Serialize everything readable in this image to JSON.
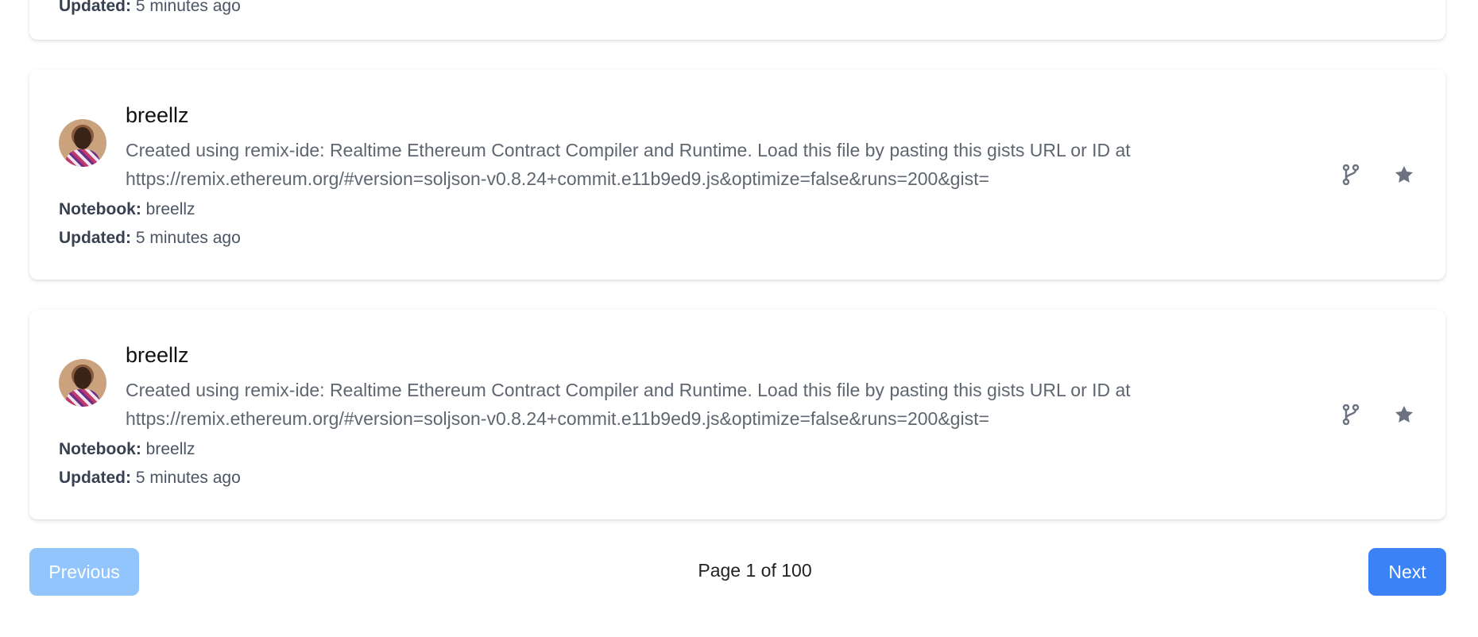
{
  "partial_card": {
    "updated_label": "Updated:",
    "updated_value": "5 minutes ago"
  },
  "cards": [
    {
      "name": "breellz",
      "description_line1": "Created using remix-ide: Realtime Ethereum Contract Compiler and Runtime. Load this file by pasting this gists URL or ID at",
      "description_line2": "https://remix.ethereum.org/#version=soljson-v0.8.24+commit.e11b9ed9.js&optimize=false&runs=200&gist=",
      "notebook_label": "Notebook:",
      "notebook_value": "breellz",
      "updated_label": "Updated:",
      "updated_value": "5 minutes ago",
      "fork_icon": "git-fork-icon",
      "star_icon": "star-icon"
    },
    {
      "name": "breellz",
      "description_line1": "Created using remix-ide: Realtime Ethereum Contract Compiler and Runtime. Load this file by pasting this gists URL or ID at",
      "description_line2": "https://remix.ethereum.org/#version=soljson-v0.8.24+commit.e11b9ed9.js&optimize=false&runs=200&gist=",
      "notebook_label": "Notebook:",
      "notebook_value": "breellz",
      "updated_label": "Updated:",
      "updated_value": "5 minutes ago",
      "fork_icon": "git-fork-icon",
      "star_icon": "star-icon"
    }
  ],
  "pagination": {
    "previous_label": "Previous",
    "next_label": "Next",
    "page_text": "Page 1 of 100",
    "previous_disabled": true
  },
  "colors": {
    "next_button": "#3b82f6",
    "previous_button_disabled": "#93c5fd",
    "icon": "#6b7280"
  }
}
